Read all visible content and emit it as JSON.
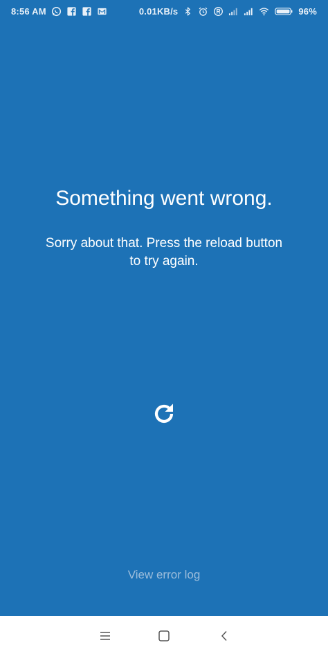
{
  "status_bar": {
    "time": "8:56 AM",
    "network_speed": "0.01KB/s",
    "battery_percent": "96%",
    "left_icons": [
      "whatsapp-icon",
      "facebook-icon",
      "facebook-icon",
      "gmail-icon"
    ],
    "right_icons": [
      "bluetooth-icon",
      "alarm-icon",
      "registered-icon",
      "signal-icon",
      "signal-icon",
      "wifi-icon",
      "battery-icon"
    ]
  },
  "error": {
    "title": "Something went wrong.",
    "message": "Sorry about that. Press the reload button to try again."
  },
  "reload": {
    "icon": "reload-icon"
  },
  "footer": {
    "view_error_log_label": "View error log"
  },
  "nav_bar": {
    "icons": [
      "menu-icon",
      "home-icon",
      "back-icon"
    ]
  },
  "colors": {
    "background": "#1d72b6",
    "text": "#ffffff",
    "link": "#9cbddb",
    "nav_bar": "#ffffff"
  }
}
